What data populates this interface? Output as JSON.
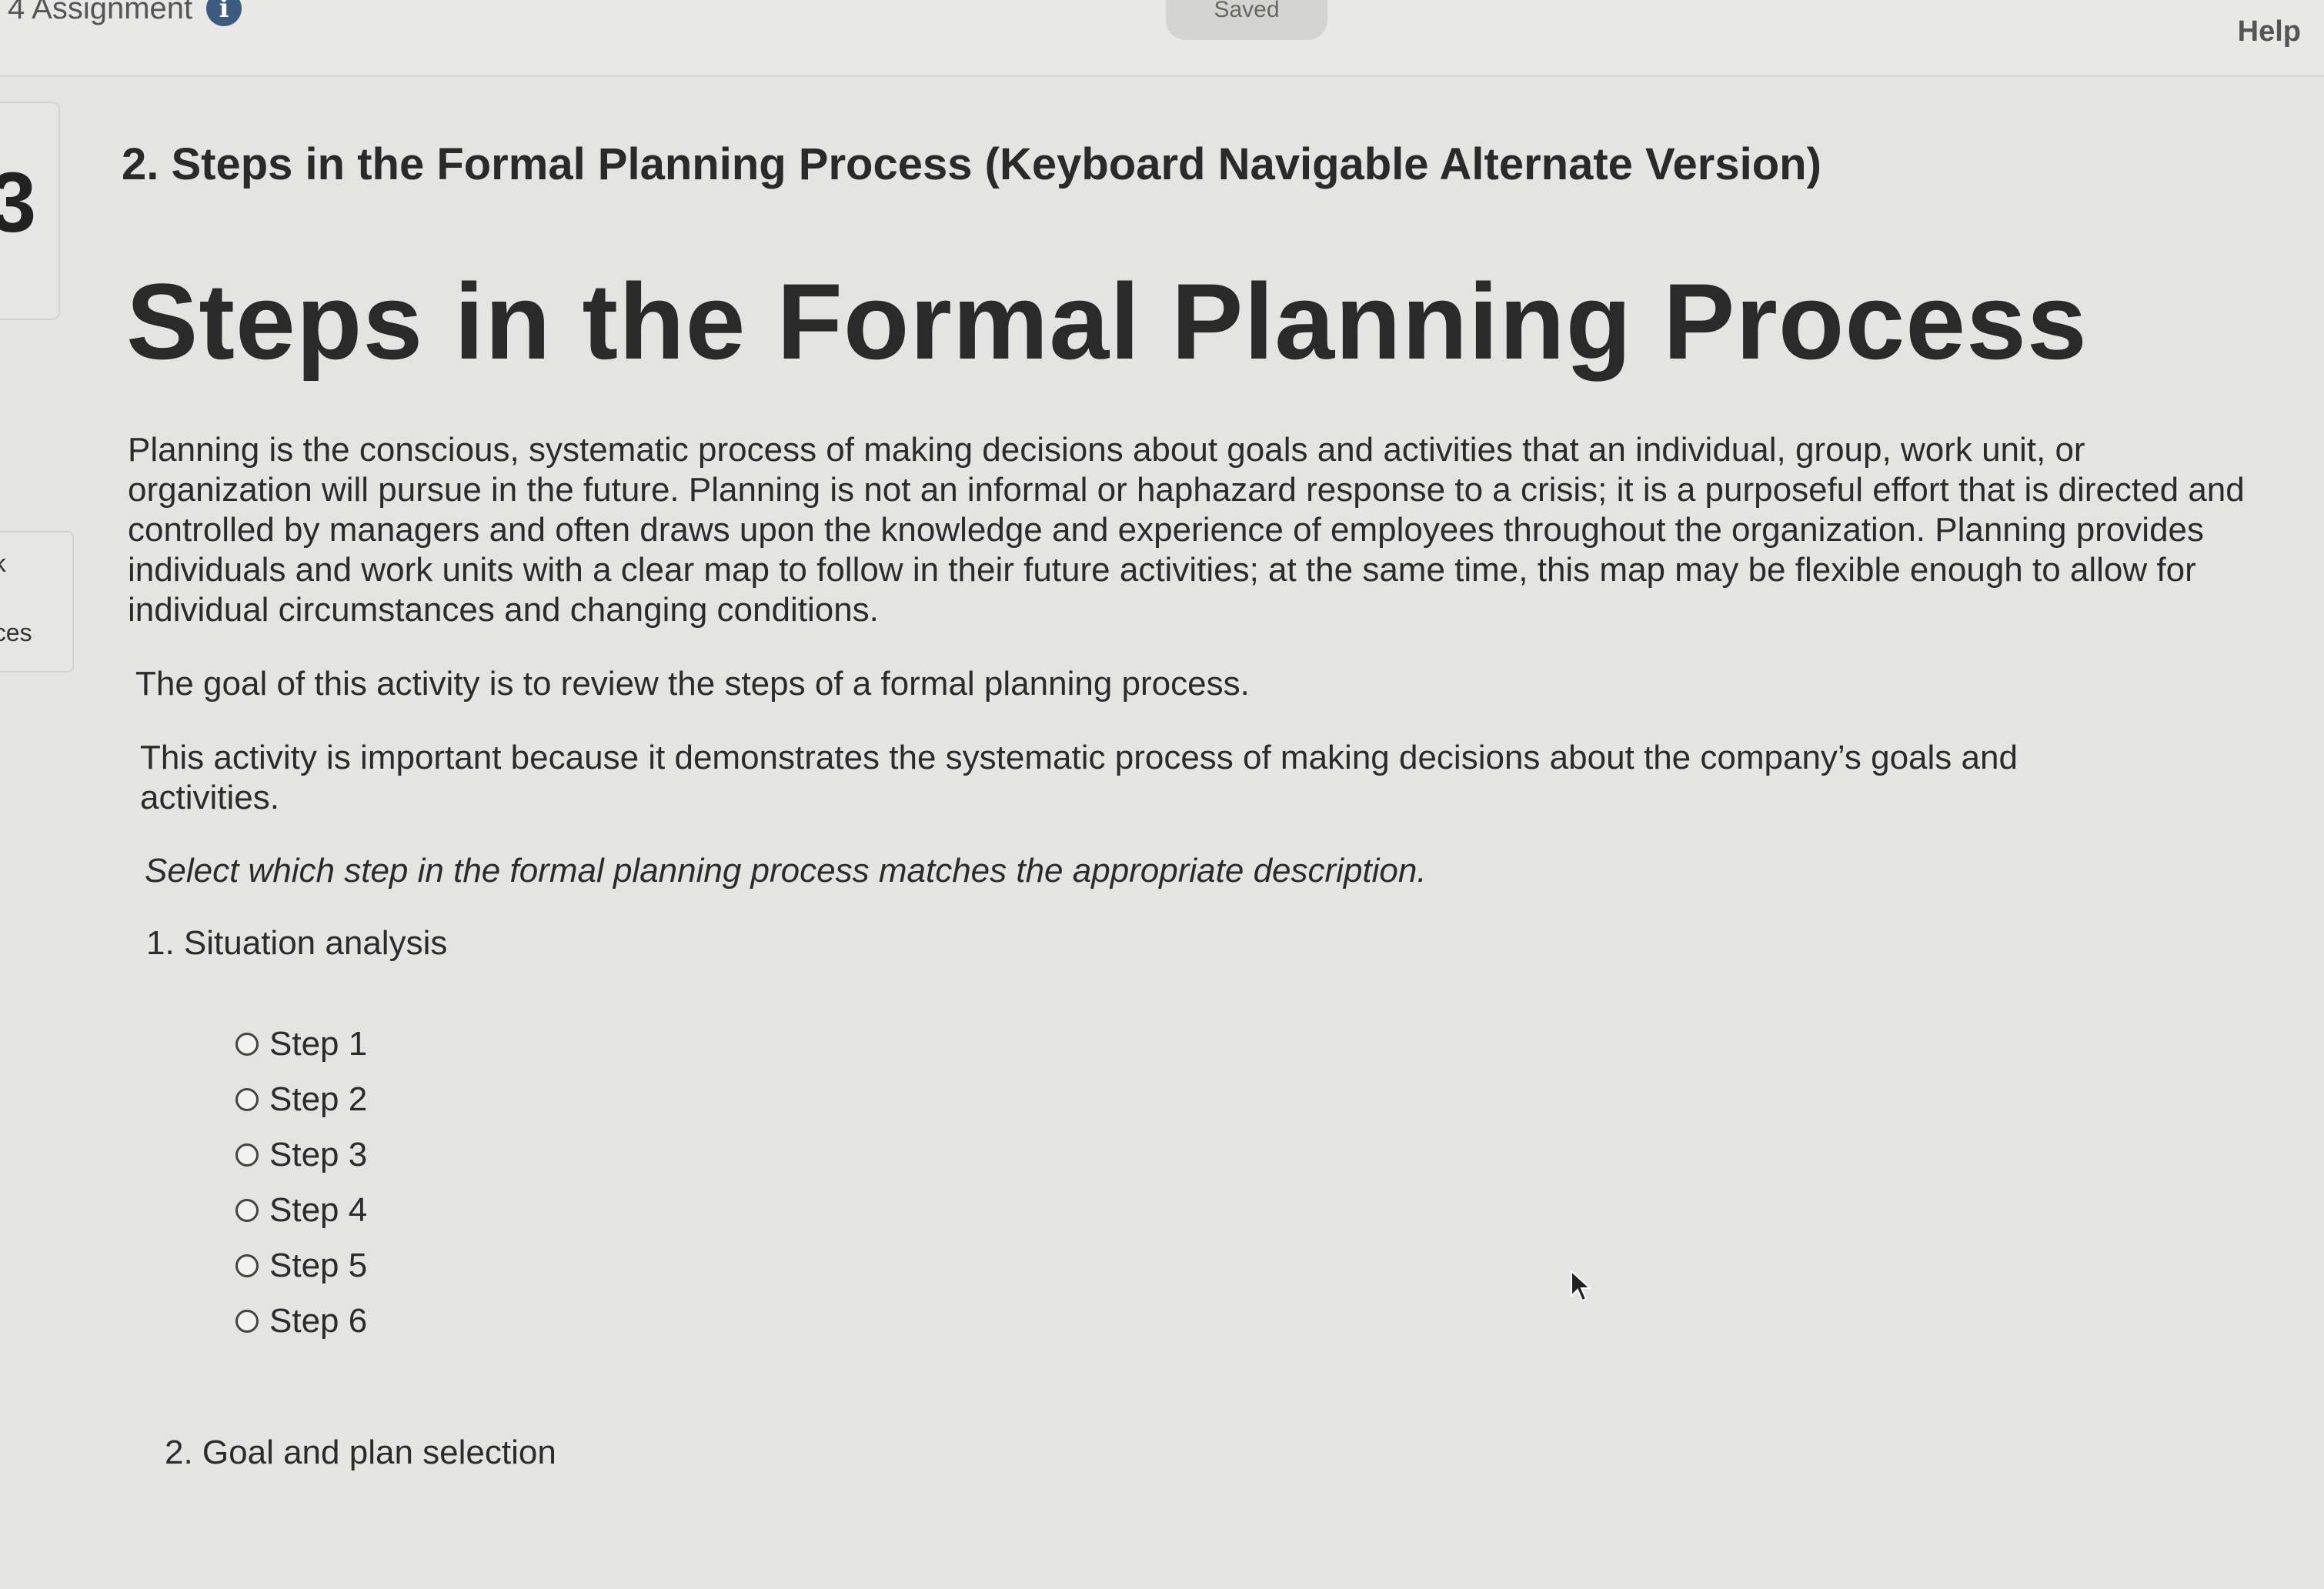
{
  "header": {
    "assignment_title": "4 Assignment",
    "info_icon": "info-icon",
    "save_status": "Saved",
    "help_label": "Help"
  },
  "sidebar": {
    "glyph": "3",
    "link_1": "ok",
    "link_2": "nces"
  },
  "question": {
    "heading": "2. Steps in the Formal Planning Process (Keyboard Navigable Alternate Version)",
    "title": "Steps in the Formal Planning Process",
    "intro": "Planning is the conscious, systematic process of making decisions about goals and activities that an individual, group, work unit, or organization will pursue in the future. Planning is not an informal or haphazard response to a crisis; it is a purposeful effort that is directed and controlled by managers and often draws upon the knowledge and experience of employees throughout the organization. Planning provides individuals and work units with a clear map to follow in their future activities; at the same time, this map may be flexible enough to allow for individual circumstances and changing conditions.",
    "goal": "The goal of this activity is to review the steps of a formal planning process.",
    "importance": "This activity is important because it demonstrates the systematic process of making decisions about the company’s goals and activities.",
    "instruction": "Select which step in the formal planning process matches the appropriate description.",
    "items": [
      {
        "label": "1. Situation analysis",
        "options": [
          "Step 1",
          "Step 2",
          "Step 3",
          "Step 4",
          "Step 5",
          "Step 6"
        ],
        "selected": null
      },
      {
        "label": "2. Goal and plan selection"
      }
    ]
  }
}
